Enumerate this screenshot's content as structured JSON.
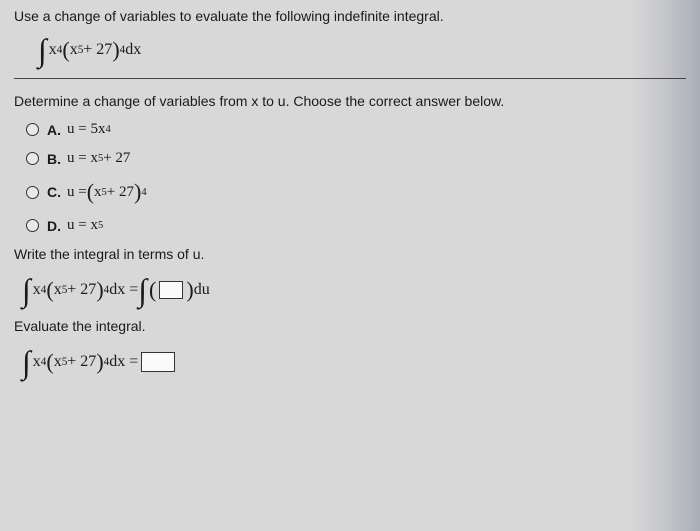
{
  "prompt_main": "Use a change of variables to evaluate the following indefinite integral.",
  "integral": {
    "integrand_pre": "x",
    "exp1": "4",
    "paren_open": "(",
    "inner_x": "x",
    "exp2": "5",
    "plus_const": " + 27",
    "paren_close": ")",
    "exp3": "4",
    "dx": " dx"
  },
  "sub_prompt": "Determine a change of variables from x to u. Choose the correct answer below.",
  "options": {
    "a": {
      "letter": "A.",
      "pre": "u = 5x",
      "sup": "4"
    },
    "b": {
      "letter": "B.",
      "pre": "u = x",
      "sup": "5",
      "post": " + 27"
    },
    "c": {
      "letter": "C.",
      "pre": "u = ",
      "paren_open": "(",
      "inner_pre": "x",
      "inner_sup": "5",
      "inner_post": " + 27",
      "paren_close": ")",
      "outer_sup": "4"
    },
    "d": {
      "letter": "D.",
      "pre": "u = x",
      "sup": "5"
    }
  },
  "write_prompt": "Write the integral in terms of u.",
  "eq1": {
    "eq_text": " dx = ",
    "du": " du"
  },
  "eval_prompt": "Evaluate the integral.",
  "eq2": {
    "eq_text": " dx = "
  }
}
